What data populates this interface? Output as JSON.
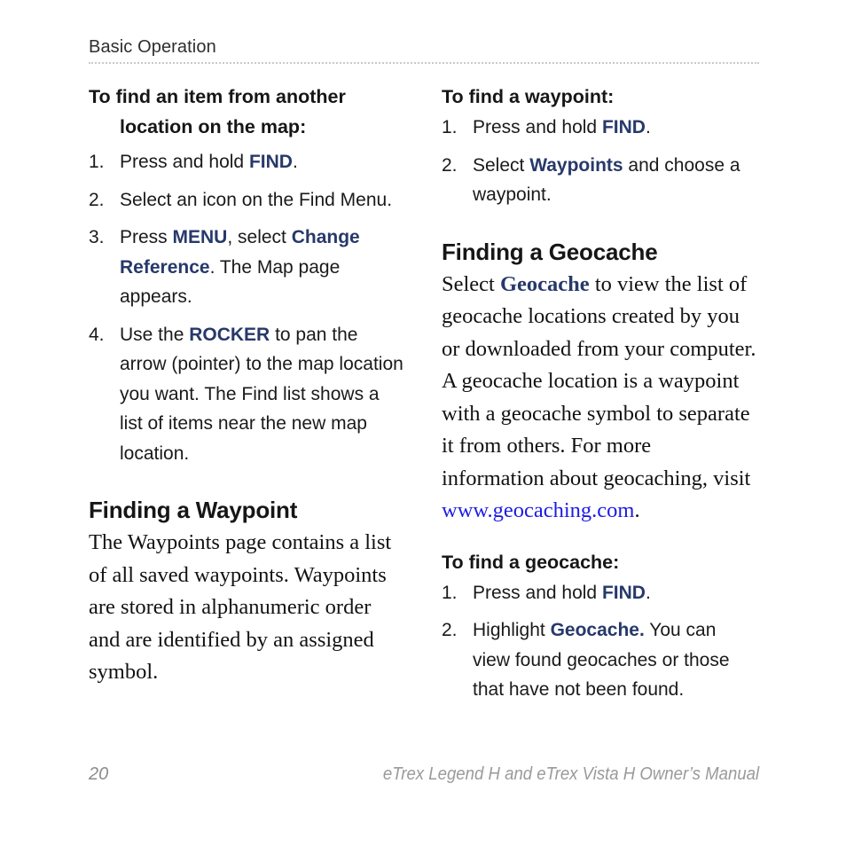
{
  "document": {
    "running_header": "Basic Operation",
    "page_number": "20",
    "footer_title": "eTrex Legend H and eTrex Vista H Owner’s Manual"
  },
  "colors": {
    "key_term": "#27396a",
    "hyperlink": "#1c1ce6",
    "body_text": "#121212",
    "footer_text": "#9a9a9a",
    "rule": "#c9c9c9"
  },
  "left_column": {
    "procedure_1": {
      "title": "To find an item from another location on the map:",
      "steps": [
        {
          "number": "1.",
          "parts": [
            {
              "text": "Press and hold ",
              "style": "plain"
            },
            {
              "text": "FIND",
              "style": "key"
            },
            {
              "text": ".",
              "style": "plain"
            }
          ]
        },
        {
          "number": "2.",
          "parts": [
            {
              "text": "Select an icon on the Find Menu.",
              "style": "plain"
            }
          ]
        },
        {
          "number": "3.",
          "parts": [
            {
              "text": "Press ",
              "style": "plain"
            },
            {
              "text": "MENU",
              "style": "key"
            },
            {
              "text": ", select ",
              "style": "plain"
            },
            {
              "text": "Change Reference",
              "style": "key"
            },
            {
              "text": ". The Map page appears.",
              "style": "plain"
            }
          ]
        },
        {
          "number": "4.",
          "parts": [
            {
              "text": "Use the ",
              "style": "plain"
            },
            {
              "text": "ROCKER",
              "style": "key"
            },
            {
              "text": " to pan the arrow (pointer) to the map location you want. The Find list shows a list of items near the new map location.",
              "style": "plain"
            }
          ]
        }
      ]
    },
    "section": {
      "heading": "Finding a Waypoint",
      "paragraph": "The Waypoints page contains a list of all saved waypoints. Waypoints are stored in alphanumeric order and are identified by an assigned symbol."
    }
  },
  "right_column": {
    "procedure_1": {
      "title": "To find a waypoint:",
      "steps": [
        {
          "number": "1.",
          "parts": [
            {
              "text": "Press and hold ",
              "style": "plain"
            },
            {
              "text": "FIND",
              "style": "key"
            },
            {
              "text": ".",
              "style": "plain"
            }
          ]
        },
        {
          "number": "2.",
          "parts": [
            {
              "text": "Select ",
              "style": "plain"
            },
            {
              "text": "Waypoints",
              "style": "key"
            },
            {
              "text": " and choose a waypoint.",
              "style": "plain"
            }
          ]
        }
      ]
    },
    "section": {
      "heading": "Finding a Geocache",
      "paragraph_parts": [
        {
          "text": "Select ",
          "style": "plain"
        },
        {
          "text": "Geocache",
          "style": "key-serif"
        },
        {
          "text": " to view the list of geocache locations created by you or downloaded from your computer. A geocache location is a waypoint with a geocache symbol to separate it from others. For more information about geocaching, visit ",
          "style": "plain"
        },
        {
          "text": "www.geocaching.com",
          "style": "link"
        },
        {
          "text": ".",
          "style": "plain"
        }
      ],
      "link_url_text": "www.geocaching.com"
    },
    "procedure_2": {
      "title": "To find a geocache:",
      "steps": [
        {
          "number": "1.",
          "parts": [
            {
              "text": "Press and hold ",
              "style": "plain"
            },
            {
              "text": "FIND",
              "style": "key"
            },
            {
              "text": ".",
              "style": "plain"
            }
          ]
        },
        {
          "number": "2.",
          "parts": [
            {
              "text": "Highlight ",
              "style": "plain"
            },
            {
              "text": "Geocache.",
              "style": "key"
            },
            {
              "text": " You can view found geocaches or those that have not been found.",
              "style": "plain"
            }
          ]
        }
      ]
    }
  }
}
